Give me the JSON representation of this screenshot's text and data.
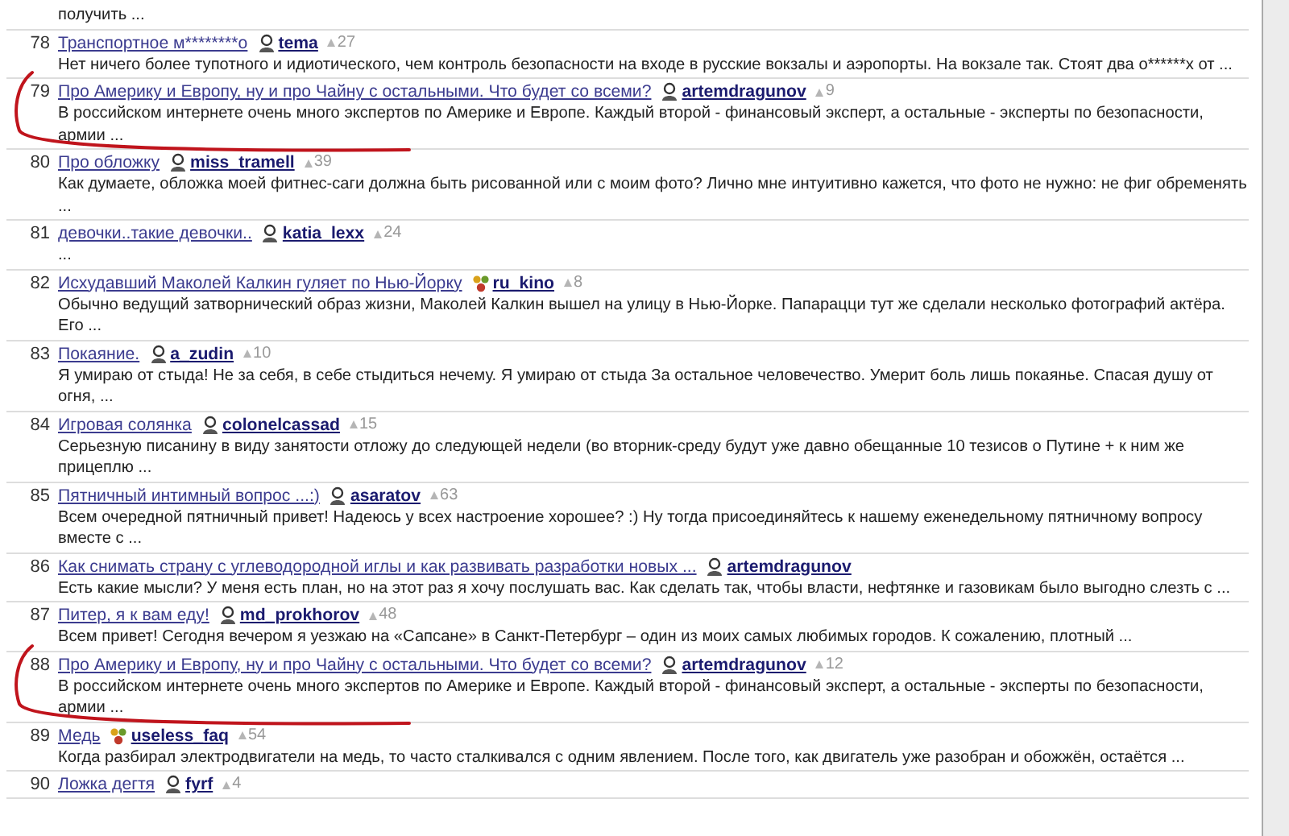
{
  "entries": [
    {
      "body": "получить ..."
    },
    {
      "number": "78",
      "title": "Транспортное м********о",
      "author": {
        "name": "tema",
        "kind": "user"
      },
      "rating": "27",
      "annotated": false,
      "body": "Нет ничего более тупотного и идиотического, чем контроль безопасности на входе в русские вокзалы и аэропорты. На вокзале так. Стоят два о******х от ..."
    },
    {
      "number": "79",
      "title": "Про Америку и Европу, ну и про Чайну с остальными. Что будет со всеми?",
      "author": {
        "name": "artemdragunov",
        "kind": "user"
      },
      "rating": "9",
      "annotated": true,
      "body": "В российском интернете очень много экспертов по Америке и Европе. Каждый второй - финансовый эксперт, а остальные - эксперты по безопасности, армии ..."
    },
    {
      "number": "80",
      "title": "Про обложку",
      "author": {
        "name": "miss_tramell",
        "kind": "user"
      },
      "rating": "39",
      "annotated": false,
      "body": "Как думаете, обложка моей фитнес-саги должна быть рисованной или с моим фото? Лично мне интуитивно кажется, что фото не нужно: не фиг обременять ..."
    },
    {
      "number": "81",
      "title": "девочки..такие девочки..",
      "author": {
        "name": "katia_lexx",
        "kind": "user"
      },
      "rating": "24",
      "annotated": false,
      "body": "..."
    },
    {
      "number": "82",
      "title": "Исхудавший Маколей Калкин гуляет по Нью-Йорку",
      "author": {
        "name": "ru_kino",
        "kind": "community"
      },
      "rating": "8",
      "annotated": false,
      "body": "Обычно ведущий затворнический образ жизни, Маколей Калкин вышел на улицу в Нью-Йорке. Папарацци тут же сделали несколько фотографий актёра. Его ..."
    },
    {
      "number": "83",
      "title": "Покаяние.",
      "author": {
        "name": "a_zudin",
        "kind": "user"
      },
      "rating": "10",
      "annotated": false,
      "body": "Я умираю от стыда! Не за себя, в себе стыдиться нечему. Я умираю от стыда За остальное человечество. Умерит боль лишь покаянье. Спасая душу от огня, ..."
    },
    {
      "number": "84",
      "title": "Игровая солянка",
      "author": {
        "name": "colonelcassad",
        "kind": "user"
      },
      "rating": "15",
      "annotated": false,
      "body": "Серьезную писанину в виду занятости отложу до следующей недели (во вторник-среду будут уже давно обещанные 10 тезисов о Путине + к ним же прицеплю ..."
    },
    {
      "number": "85",
      "title": "Пятничный интимный вопрос ...:)",
      "author": {
        "name": "asaratov",
        "kind": "user"
      },
      "rating": "63",
      "annotated": false,
      "body": "Всем очередной пятничный привет! Надеюсь у всех настроение хорошее? :) Ну тогда присоединяйтесь к нашему еженедельному пятничному вопросу вместе с ..."
    },
    {
      "number": "86",
      "title": "Как снимать страну с углеводородной иглы и как развивать разработки новых ...",
      "author": {
        "name": "artemdragunov",
        "kind": "user"
      },
      "annotated": false,
      "body": "Есть какие мысли? У меня есть план, но на этот раз я хочу послушать вас. Как сделать так, чтобы власти, нефтянке и газовикам было выгодно слезть с ..."
    },
    {
      "number": "87",
      "title": "Питер, я к вам еду!",
      "author": {
        "name": "md_prokhorov",
        "kind": "user"
      },
      "rating": "48",
      "annotated": false,
      "body": "Всем привет! Сегодня вечером я уезжаю на «Сапсане» в Санкт-Петербург – один из моих самых любимых городов. К сожалению, плотный ..."
    },
    {
      "number": "88",
      "title": "Про Америку и Европу, ну и про Чайну с остальными. Что будет со всеми?",
      "author": {
        "name": "artemdragunov",
        "kind": "user"
      },
      "rating": "12",
      "annotated": true,
      "body": "В российском интернете очень много экспертов по Америке и Европе. Каждый второй - финансовый эксперт, а остальные - эксперты по безопасности, армии ..."
    },
    {
      "number": "89",
      "title": "Медь",
      "author": {
        "name": "useless_faq",
        "kind": "community"
      },
      "rating": "54",
      "annotated": false,
      "body": "Когда разбирал электродвигатели на медь, то часто сталкивался с одним явлением. После того, как двигатель уже разобран и обожжён, остаётся ..."
    },
    {
      "number": "90",
      "title": "Ложка дегтя",
      "author": {
        "name": "fyrf",
        "kind": "user"
      },
      "rating": "4",
      "annotated": false
    }
  ]
}
